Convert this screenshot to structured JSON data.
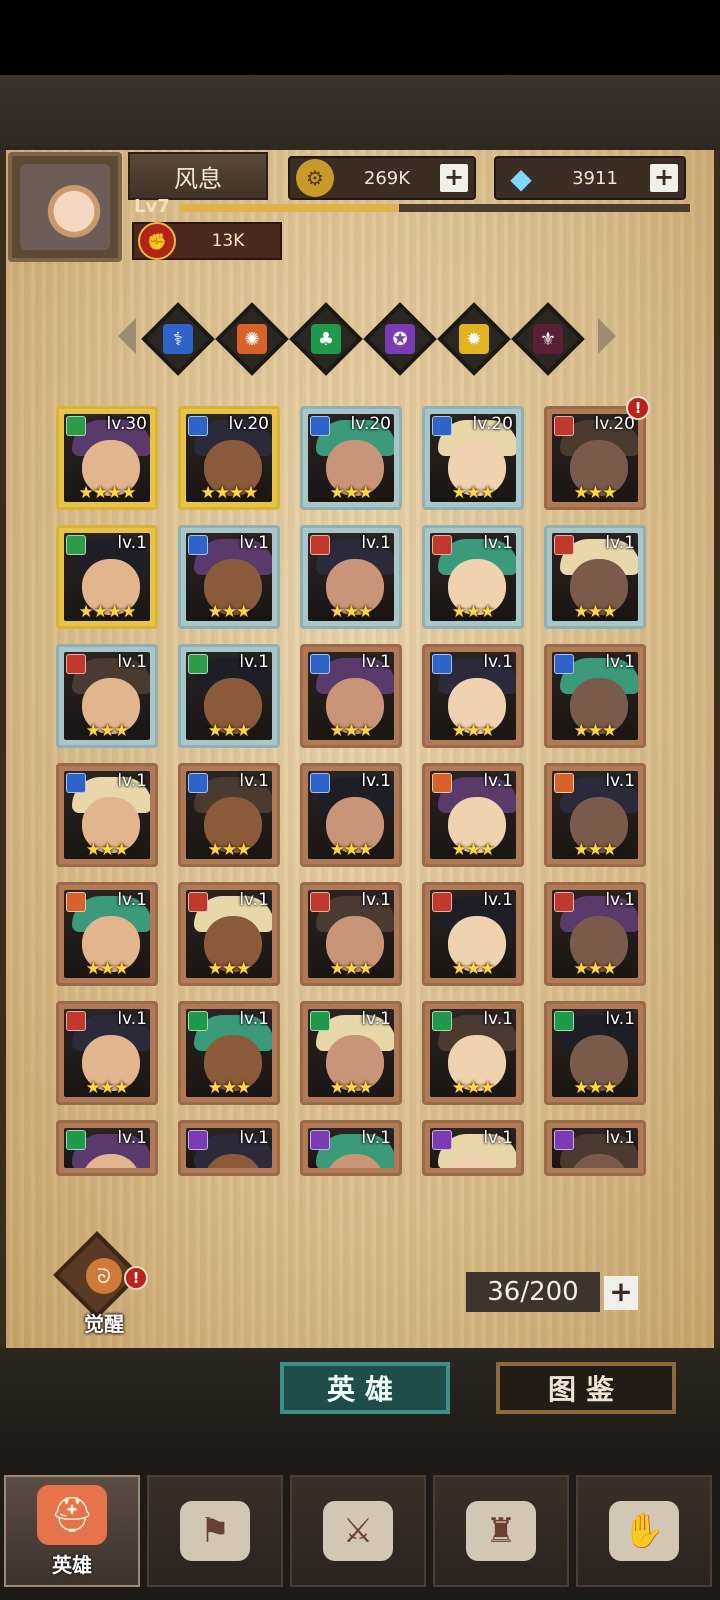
{
  "player": {
    "name": "风息",
    "level": "Lv7",
    "power": "13K",
    "xp_fraction": 0.43
  },
  "resources": {
    "gold": "269K",
    "gems": "3911"
  },
  "filters": [
    {
      "name": "blue-element-icon",
      "color": "#2e63c7",
      "glyph": "⚕"
    },
    {
      "name": "orange-element-icon",
      "color": "#d9622a",
      "glyph": "✺"
    },
    {
      "name": "green-element-icon",
      "color": "#1e9a4a",
      "glyph": "♣"
    },
    {
      "name": "purple-element-icon",
      "color": "#7a3bb5",
      "glyph": "✪"
    },
    {
      "name": "gold-element-icon",
      "color": "#e2b423",
      "glyph": "✹"
    },
    {
      "name": "dark-element-icon",
      "color": "#5a1f36",
      "glyph": "⚜"
    }
  ],
  "heroes": [
    {
      "level": "lv.30",
      "stars": "★★★★",
      "frame": "gold",
      "cls": "#2e9a4a"
    },
    {
      "level": "lv.20",
      "stars": "★★★★",
      "frame": "gold",
      "cls": "#2e63c7"
    },
    {
      "level": "lv.20",
      "stars": "★★★",
      "frame": "silver",
      "cls": "#2e63c7"
    },
    {
      "level": "lv.20",
      "stars": "★★★",
      "frame": "silver",
      "cls": "#2e63c7"
    },
    {
      "level": "lv.20",
      "stars": "★★★",
      "frame": "bronze",
      "cls": "#c0392b",
      "alert": true
    },
    {
      "level": "lv.1",
      "stars": "★★★★",
      "frame": "gold",
      "cls": "#2e9a4a"
    },
    {
      "level": "lv.1",
      "stars": "★★★",
      "frame": "silver",
      "cls": "#2e63c7"
    },
    {
      "level": "lv.1",
      "stars": "★★★",
      "frame": "silver",
      "cls": "#c0392b"
    },
    {
      "level": "lv.1",
      "stars": "★★★",
      "frame": "silver",
      "cls": "#c0392b"
    },
    {
      "level": "lv.1",
      "stars": "★★★",
      "frame": "silver",
      "cls": "#c0392b"
    },
    {
      "level": "lv.1",
      "stars": "★★★",
      "frame": "silver",
      "cls": "#c0392b"
    },
    {
      "level": "lv.1",
      "stars": "★★★",
      "frame": "silver",
      "cls": "#2e9a4a"
    },
    {
      "level": "lv.1",
      "stars": "★★★",
      "frame": "bronze",
      "cls": "#2e63c7"
    },
    {
      "level": "lv.1",
      "stars": "★★★",
      "frame": "bronze",
      "cls": "#2e63c7"
    },
    {
      "level": "lv.1",
      "stars": "★★★",
      "frame": "bronze",
      "cls": "#2e63c7"
    },
    {
      "level": "lv.1",
      "stars": "★★★",
      "frame": "bronze",
      "cls": "#2e63c7"
    },
    {
      "level": "lv.1",
      "stars": "★★★",
      "frame": "bronze",
      "cls": "#2e63c7"
    },
    {
      "level": "lv.1",
      "stars": "★★★",
      "frame": "bronze",
      "cls": "#2e63c7"
    },
    {
      "level": "lv.1",
      "stars": "★★★",
      "frame": "bronze",
      "cls": "#d9622a"
    },
    {
      "level": "lv.1",
      "stars": "★★★",
      "frame": "bronze",
      "cls": "#d9622a"
    },
    {
      "level": "lv.1",
      "stars": "★★★",
      "frame": "bronze",
      "cls": "#d9622a"
    },
    {
      "level": "lv.1",
      "stars": "★★★",
      "frame": "bronze",
      "cls": "#c0392b"
    },
    {
      "level": "lv.1",
      "stars": "★★★",
      "frame": "bronze",
      "cls": "#c0392b"
    },
    {
      "level": "lv.1",
      "stars": "★★★",
      "frame": "bronze",
      "cls": "#c0392b"
    },
    {
      "level": "lv.1",
      "stars": "★★★",
      "frame": "bronze",
      "cls": "#c0392b"
    },
    {
      "level": "lv.1",
      "stars": "★★★",
      "frame": "bronze",
      "cls": "#c0392b"
    },
    {
      "level": "lv.1",
      "stars": "★★★",
      "frame": "bronze",
      "cls": "#1e9a4a"
    },
    {
      "level": "lv.1",
      "stars": "★★★",
      "frame": "bronze",
      "cls": "#1e9a4a"
    },
    {
      "level": "lv.1",
      "stars": "★★★",
      "frame": "bronze",
      "cls": "#1e9a4a"
    },
    {
      "level": "lv.1",
      "stars": "★★★",
      "frame": "bronze",
      "cls": "#1e9a4a"
    },
    {
      "level": "lv.1",
      "stars": "",
      "frame": "bronze",
      "cls": "#1e9a4a"
    },
    {
      "level": "lv.1",
      "stars": "",
      "frame": "bronze",
      "cls": "#7a3bb5"
    },
    {
      "level": "lv.1",
      "stars": "",
      "frame": "bronze",
      "cls": "#7a3bb5"
    },
    {
      "level": "lv.1",
      "stars": "",
      "frame": "bronze",
      "cls": "#7a3bb5"
    },
    {
      "level": "lv.1",
      "stars": "",
      "frame": "bronze",
      "cls": "#7a3bb5"
    }
  ],
  "awaken": {
    "label": "觉醒",
    "alert": "!"
  },
  "capacity": "36/200",
  "tabs": {
    "hero": "英雄",
    "codex": "图鉴"
  },
  "nav": [
    {
      "name": "nav-heroes",
      "icon": "helmet-icon",
      "glyph": "⛑",
      "label": "英雄",
      "active": true
    },
    {
      "name": "nav-adventure",
      "icon": "flag-icon",
      "glyph": "⚑",
      "label": "",
      "active": false
    },
    {
      "name": "nav-battle",
      "icon": "crossed-swords-icon",
      "glyph": "⚔",
      "label": "",
      "active": false
    },
    {
      "name": "nav-castle",
      "icon": "castle-icon",
      "glyph": "♜",
      "label": "",
      "active": false
    },
    {
      "name": "nav-alliance",
      "icon": "handshake-icon",
      "glyph": "✋",
      "label": "",
      "active": false
    }
  ]
}
